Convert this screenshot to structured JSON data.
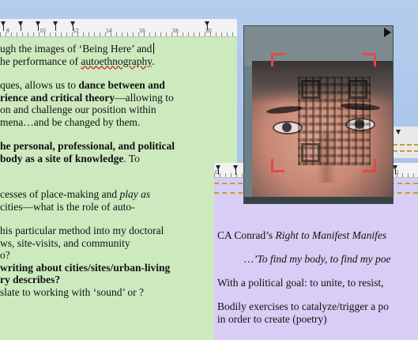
{
  "ruler_main": {
    "ticks": [
      "8",
      "10",
      "12",
      "14",
      "16",
      "18",
      "20"
    ]
  },
  "ruler_purple": {
    "ticks": [
      "0",
      "1"
    ]
  },
  "green_doc": {
    "line1": "ugh the images of ‘Being Here’ and",
    "line2a": "he performance of ",
    "line2b": "autoethnography",
    "line2c": ".",
    "line3a": "ques, allows us to ",
    "line3b": "dance between and",
    "line4a": "rience and critical theory",
    "line4b": "—allowing to",
    "line5": "on and challenge our position within",
    "line6": "mena…and be changed by them.",
    "line7": "he personal, professional, and political",
    "line8a": "body as a site of knowledge",
    "line8b": ". To",
    "line9a": "cesses of place-making and ",
    "line9b": "play as",
    "line10": "cities—what is the role of auto-",
    "line11": "his particular method into my doctoral",
    "line12": "ws, site-visits, and community",
    "line13": "o?",
    "line14": "writing about cities/sites/urban-living",
    "line15": "ry describes?",
    "line16": "slate to working with ‘sound’ or ?"
  },
  "purple_doc": {
    "line1a": "CA Conrad’s ",
    "line1b": "Right to Manifest Manifes",
    "line2": "…’To find my body, to find my poe",
    "line3": "With a political goal: to unite, to resist,",
    "line4": "Bodily exercises to catalyze/trigger a po",
    "line5": "in order to create (poetry)"
  },
  "camera": {
    "play_icon": "play-icon"
  },
  "colors": {
    "green_doc": "#cdeabf",
    "purple_doc": "#d7cdf5",
    "scan_bracket": "#e04a4a"
  }
}
